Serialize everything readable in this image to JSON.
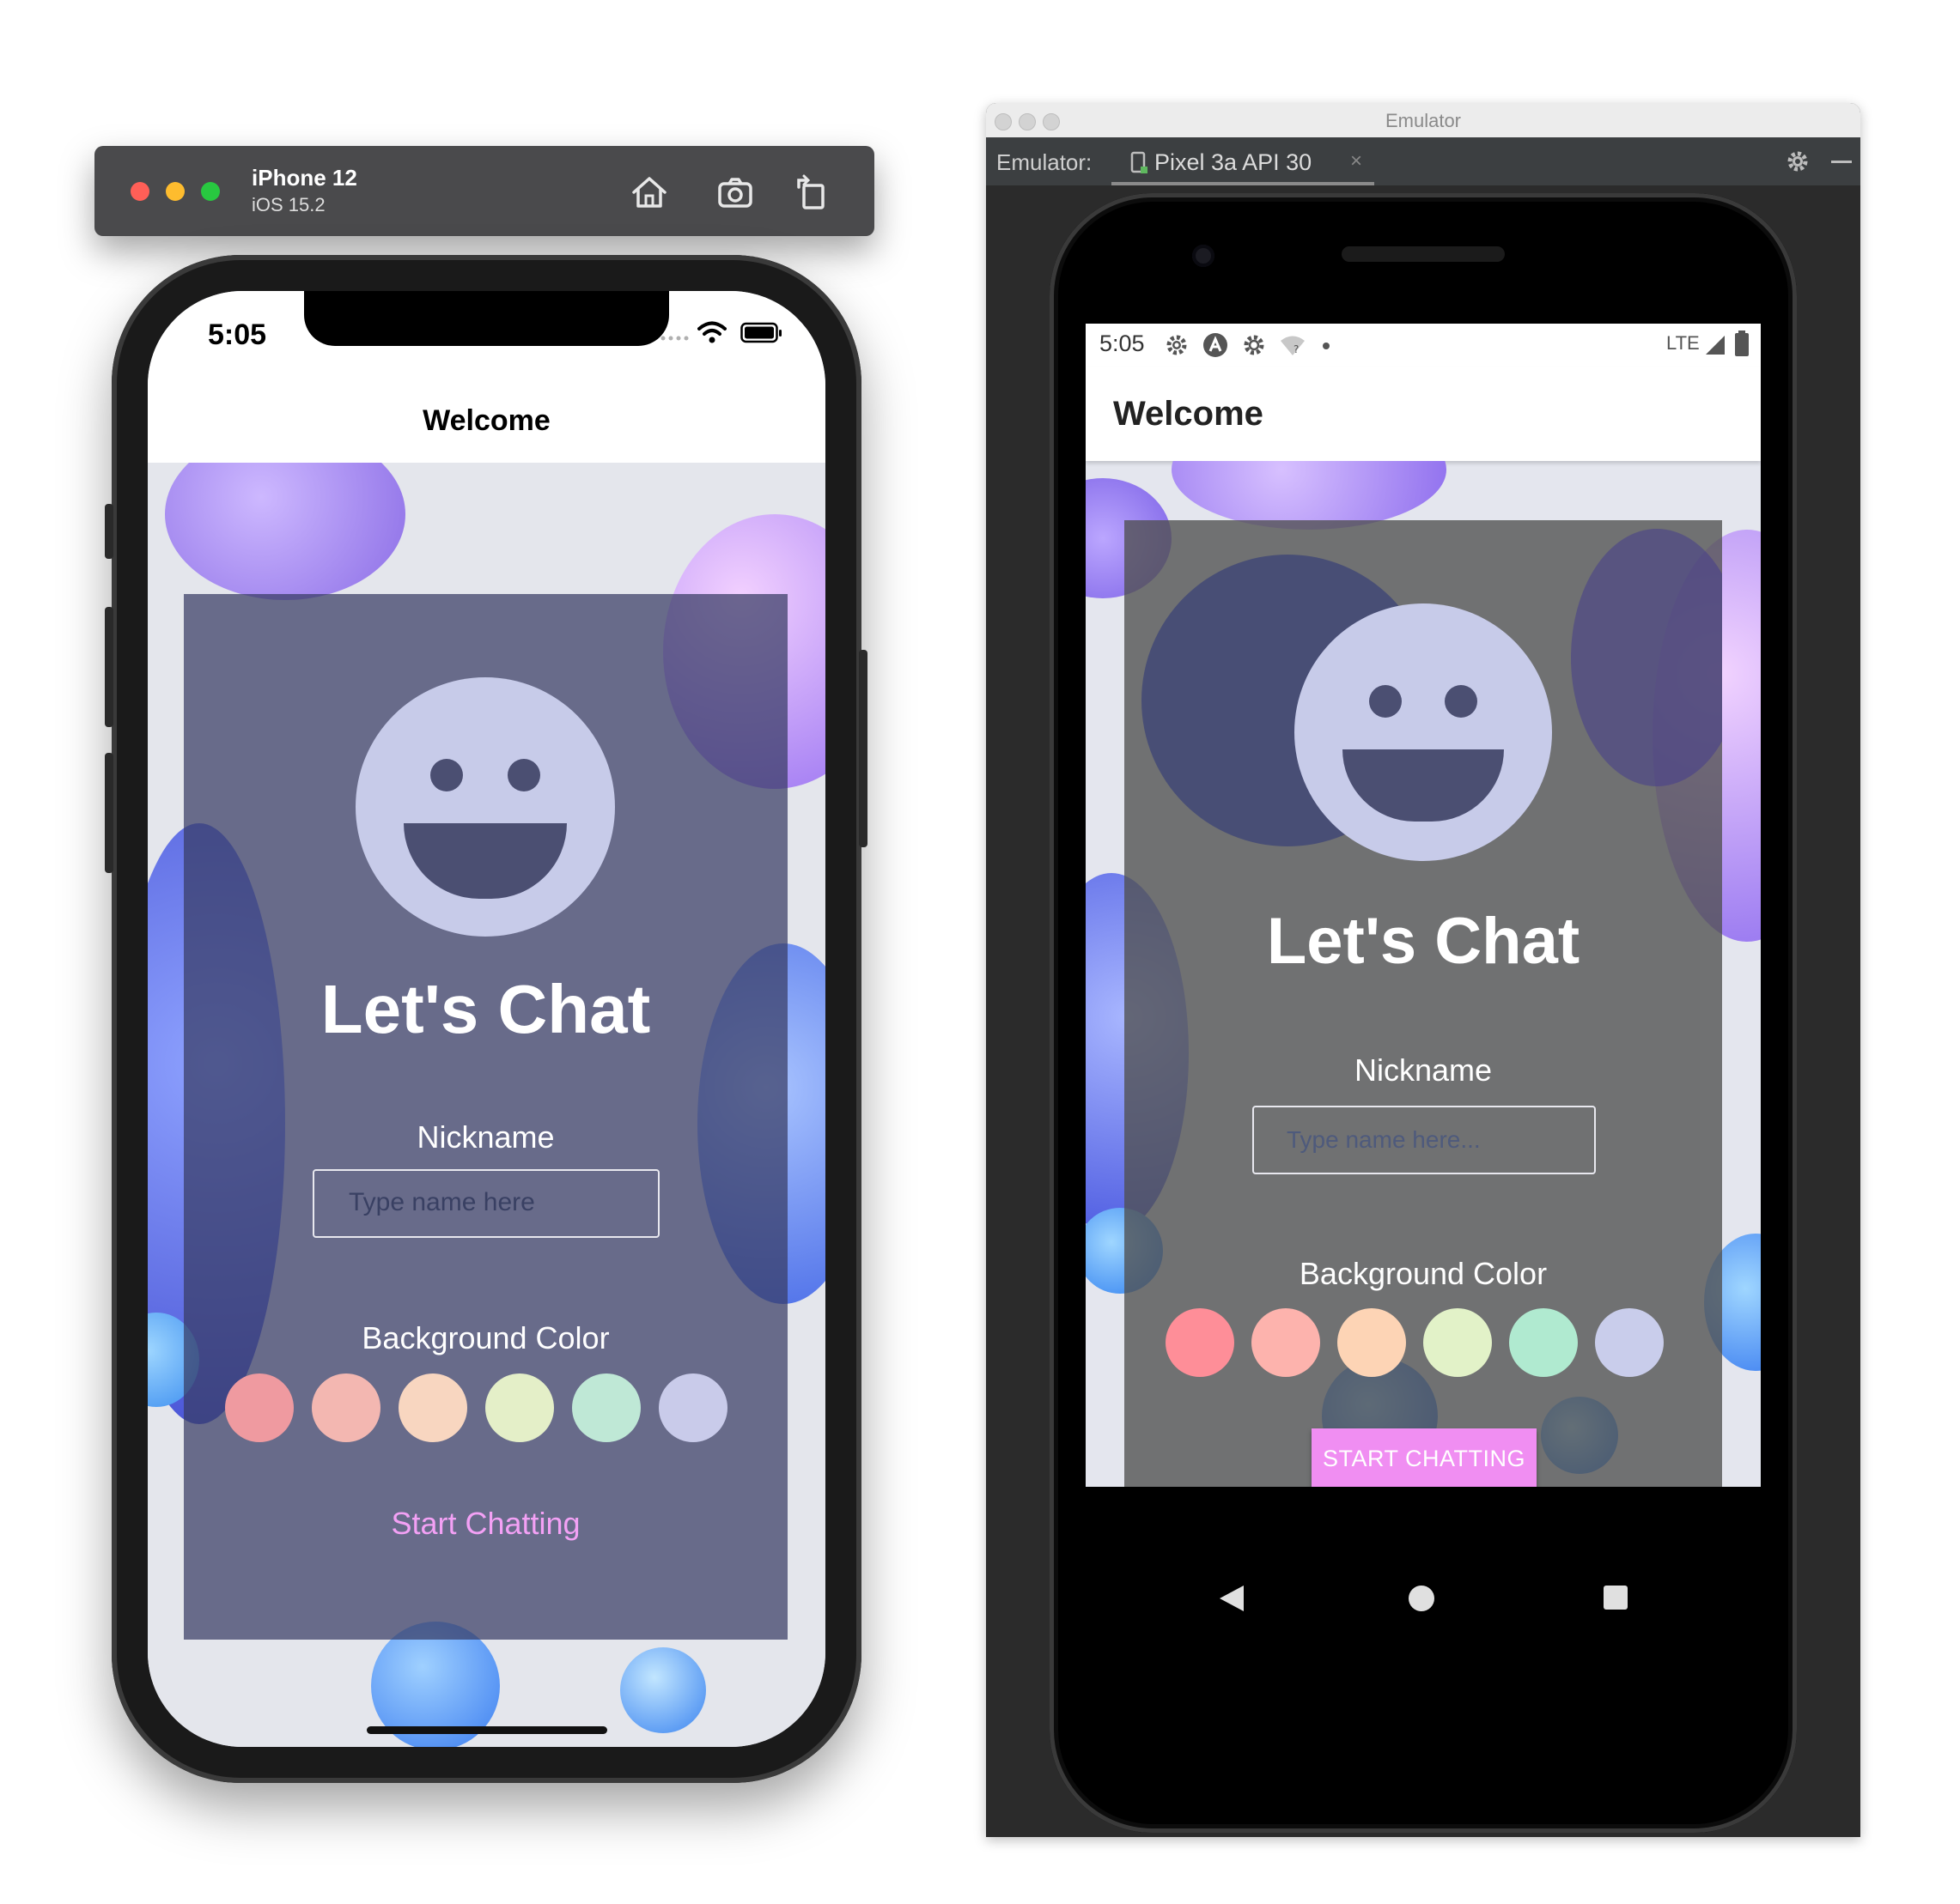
{
  "ios_simulator": {
    "device_name": "iPhone 12",
    "os_version": "iOS 15.2",
    "toolbar_icons": [
      "home-icon",
      "screenshot-icon",
      "rotate-icon"
    ],
    "status_time": "5:05",
    "nav_title": "Welcome",
    "app": {
      "title": "Let's Chat",
      "nickname_label": "Nickname",
      "nickname_placeholder": "Type name here",
      "background_label": "Background Color",
      "colors": [
        "#ef9aa0",
        "#f3b7b1",
        "#f8d6c0",
        "#e4efc8",
        "#bfe8d6",
        "#c9cbea"
      ],
      "start_button": "Start Chatting",
      "start_button_color": "#f3a1f5"
    }
  },
  "android_emulator": {
    "window_title": "Emulator",
    "emulator_label": "Emulator:",
    "device_tab": "Pixel 3a API 30",
    "status_time": "5:05",
    "network_label": "LTE",
    "app_title": "Welcome",
    "app": {
      "title": "Let's Chat",
      "nickname_label": "Nickname",
      "nickname_placeholder": "Type name here...",
      "background_label": "Background Color",
      "colors": [
        "#fe8e98",
        "#fdb3ad",
        "#fdd4b5",
        "#e2f2c8",
        "#b0ead0",
        "#c9cdeb"
      ],
      "start_button": "START CHATTING",
      "start_button_color": "#f08ef2"
    }
  }
}
